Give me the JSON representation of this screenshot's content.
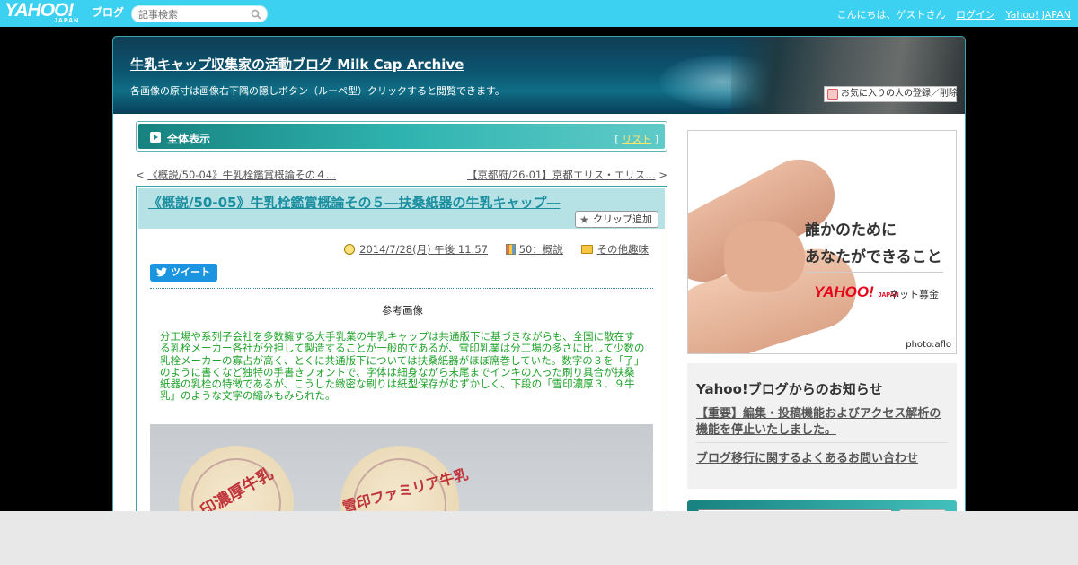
{
  "topbar": {
    "logo_text": "YAHOO!",
    "logo_sub": "JAPAN",
    "logo_blog": "ブログ",
    "search_placeholder": "記事検索",
    "greeting": "こんにちは、ゲストさん",
    "login_label": "ログイン",
    "yahoo_japan_label": "Yahoo! JAPAN",
    "bar_color": "#3cd1f0"
  },
  "header": {
    "blog_title": "牛乳キャップ収集家の活動ブログ Milk Cap Archive",
    "description": "各画像の原寸は画像右下隅の隠しボタン（ルーペ型）クリックすると閲覧できます。",
    "favorite_label": "お気に入りの人の登録／削除"
  },
  "tabbar": {
    "label": "全体表示",
    "list_open": "[",
    "list_label": "リスト",
    "list_close": "]"
  },
  "nav": {
    "prev_marker": "<",
    "prev_label": "《概説/50-04》牛乳栓鑑賞概論その４…",
    "next_label": "【京都府/26-01】京都エリス・エリス…",
    "next_marker": ">"
  },
  "article": {
    "title": "《概説/50-05》牛乳栓鑑賞概論その５―扶桑紙器の牛乳キャップ―",
    "clip_label": "クリップ追加",
    "date": "2014/7/28(月) 午後 11:57",
    "category": "50：概説",
    "genre": "その他趣味",
    "tweet_label": "ツイート",
    "caption": "参考画像",
    "body": "分工場や系列子会社を多数擁する大手乳業の牛乳キャップは共通版下に基づきながらも、全国に散在する乳栓メーカー各社が分担して製造することが一般的であるが、雪印乳業は分工場の多さに比して少数の乳栓メーカーの寡占が高く、とくに共通版下については扶桑紙器がほぼ席巻していた。数字の３を「了」のように書くなど独特の手書きフォントで、字体は細身ながら末尾までインキの入った刷り具合が扶桑紙器の乳栓の特徴であるが、こうした緻密な刷りは紙型保存がむずかしく、下段の「雪印濃厚３．９牛乳」のような文字の縮みもみられた。",
    "body_color": "#1fa32a",
    "cap1_text": "印濃厚牛乳",
    "cap2_text": "雪印ファミリア牛乳"
  },
  "sidebar": {
    "ad": {
      "line1": "誰かのために",
      "line2": "あなたができること",
      "brand": "YAHOO!",
      "brand_sub": "JAPAN",
      "service": "ネット募金",
      "credit": "photo:aflo"
    },
    "notice": {
      "heading": "Yahoo!ブログからのお知らせ",
      "item1": "【重要】編集・投稿機能およびアクセス解析の機能を停止いたしました。",
      "item2": "ブログ移行に関するよくあるお問い合わせ"
    }
  }
}
